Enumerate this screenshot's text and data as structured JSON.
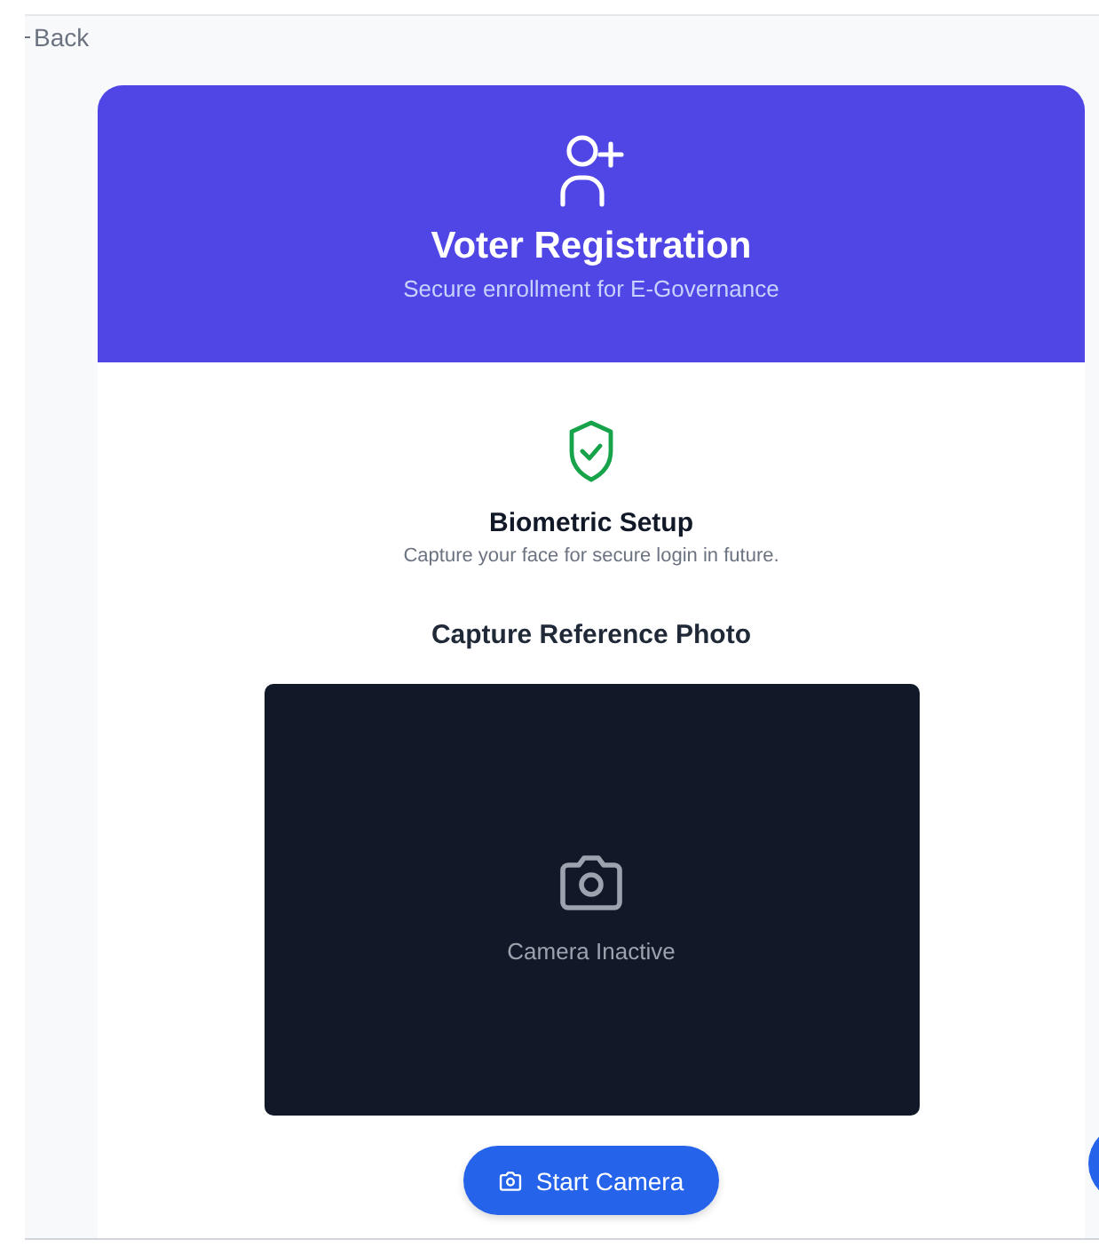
{
  "back_link": {
    "label": "Back"
  },
  "header": {
    "title": "Voter Registration",
    "subtitle": "Secure enrollment for E-Governance"
  },
  "biometric": {
    "title": "Biometric Setup",
    "description": "Capture your face for secure login in future."
  },
  "capture": {
    "heading": "Capture Reference Photo",
    "camera_status": "Camera Inactive",
    "button": "Start Camera"
  }
}
